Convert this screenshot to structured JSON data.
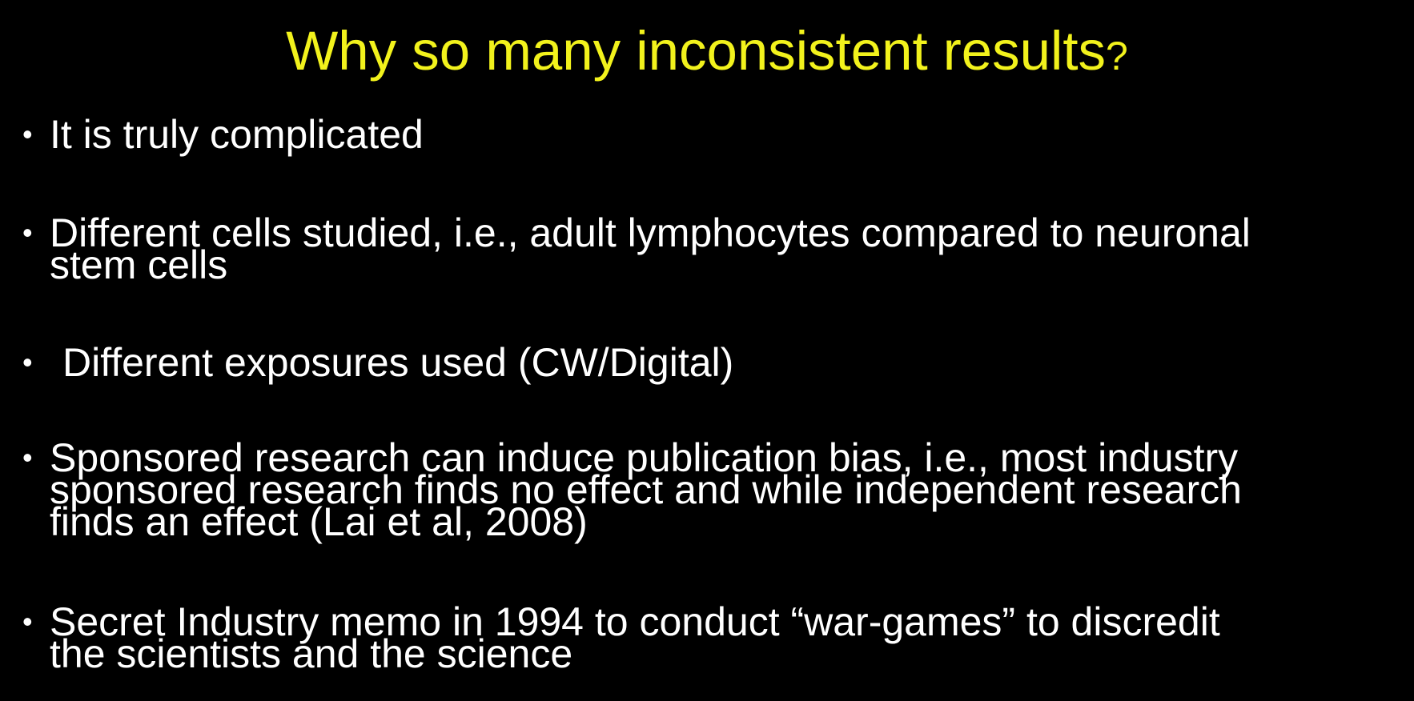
{
  "slide": {
    "title": "Why so many inconsistent results",
    "title_mark": "?",
    "bullet_char": "•",
    "bullets": [
      "It is truly complicated",
      "Different cells studied, i.e., adult lymphocytes compared to neuronal\nstem cells",
      "Different exposures used (CW/Digital)",
      "Sponsored research can induce publication bias,  i.e., most industry\nsponsored research finds no effect and while independent research\nfinds an effect (Lai et al, 2008)",
      "Secret Industry memo in 1994 to conduct “war-games” to discredit\nthe scientists and the science"
    ]
  },
  "colors": {
    "background": "#000000",
    "title": "#f2f21c",
    "body_text": "#ffffff"
  }
}
